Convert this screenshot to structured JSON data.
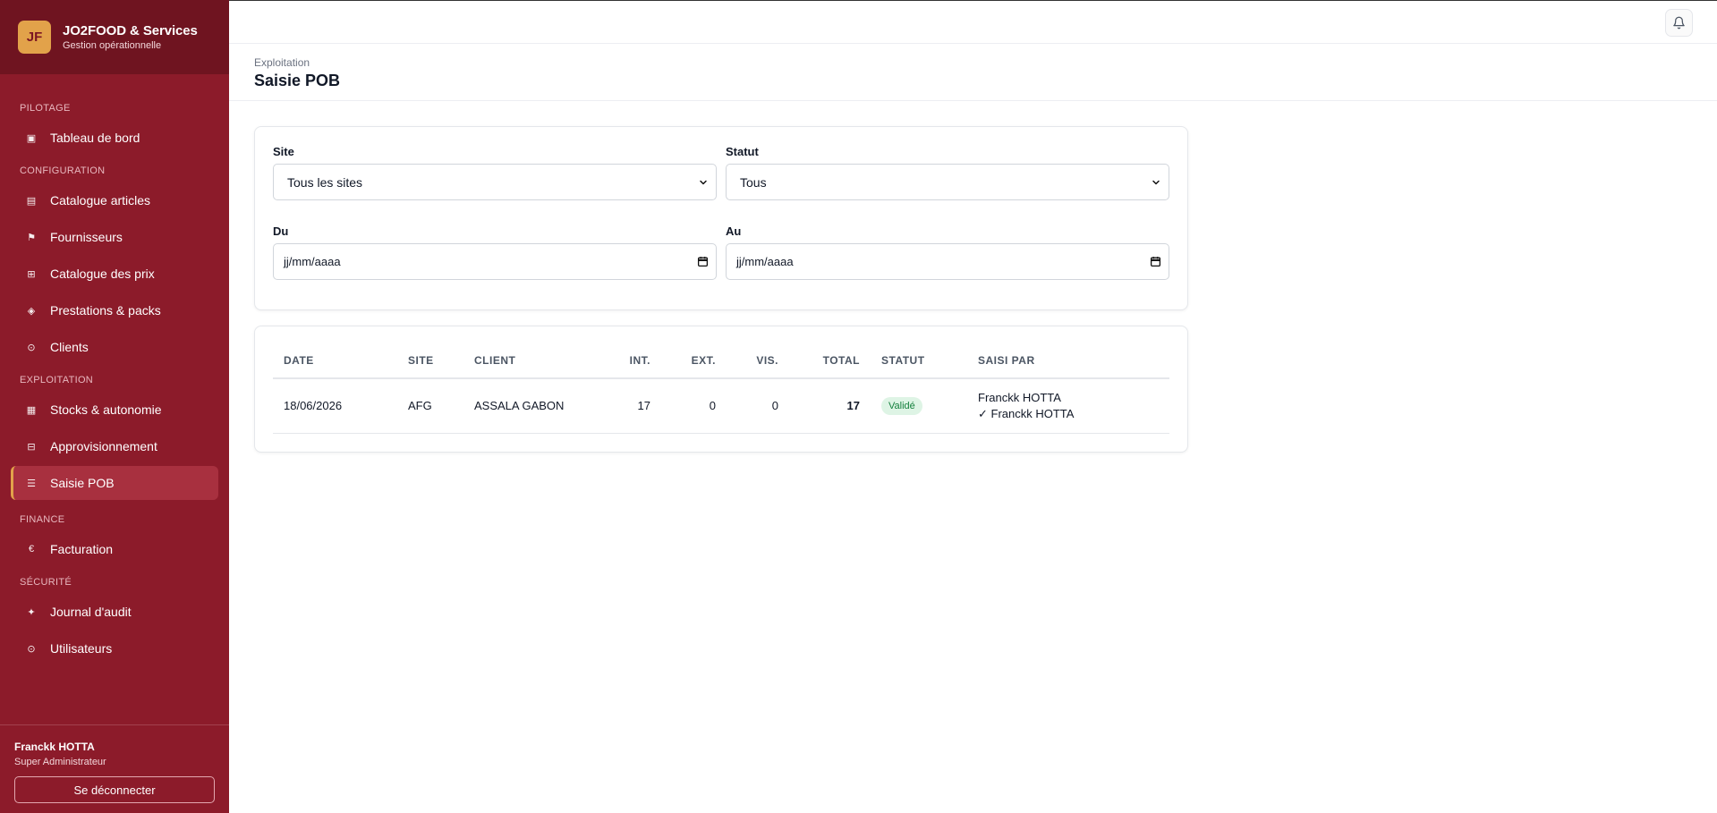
{
  "brand": {
    "logo": "JF",
    "name": "JO2FOOD & Services",
    "subtitle": "Gestion opérationnelle"
  },
  "sections": {
    "pilotage": "PILOTAGE",
    "configuration": "CONFIGURATION",
    "exploitation": "EXPLOITATION",
    "finance": "FINANCE",
    "securite": "SÉCURITÉ"
  },
  "nav": {
    "tableau": {
      "label": "Tableau de bord",
      "icon": "▣"
    },
    "catalogue_articles": {
      "label": "Catalogue articles",
      "icon": "▤"
    },
    "fournisseurs": {
      "label": "Fournisseurs",
      "icon": "⚑"
    },
    "catalogue_prix": {
      "label": "Catalogue des prix",
      "icon": "⊞"
    },
    "prestations": {
      "label": "Prestations & packs",
      "icon": "◈"
    },
    "clients": {
      "label": "Clients",
      "icon": "⊙"
    },
    "stocks": {
      "label": "Stocks & autonomie",
      "icon": "▦"
    },
    "appro": {
      "label": "Approvisionnement",
      "icon": "⊟"
    },
    "saisie_pob": {
      "label": "Saisie POB",
      "icon": "☰"
    },
    "facturation": {
      "label": "Facturation",
      "icon": "€"
    },
    "journal": {
      "label": "Journal d'audit",
      "icon": "✦"
    },
    "utilisateurs": {
      "label": "Utilisateurs",
      "icon": "⊙"
    }
  },
  "user": {
    "name": "Franckk HOTTA",
    "role": "Super Administrateur",
    "logout": "Se déconnecter"
  },
  "header": {
    "breadcrumb": "Exploitation",
    "title": "Saisie POB"
  },
  "filters": {
    "site_label": "Site",
    "site_value": "Tous les sites",
    "statut_label": "Statut",
    "statut_value": "Tous",
    "du_label": "Du",
    "du_placeholder": "jj/mm/aaaa",
    "au_label": "Au",
    "au_placeholder": "jj/mm/aaaa"
  },
  "table": {
    "headers": {
      "date": "DATE",
      "site": "SITE",
      "client": "CLIENT",
      "int": "INT.",
      "ext": "EXT.",
      "vis": "VIS.",
      "total": "TOTAL",
      "statut": "STATUT",
      "saisi_par": "SAISI PAR"
    },
    "rows": [
      {
        "date": "18/06/2026",
        "site": "AFG",
        "client": "ASSALA GABON",
        "int": "17",
        "ext": "0",
        "vis": "0",
        "total": "17",
        "statut": "Validé",
        "saisi_par": "Franckk HOTTA",
        "valide_par": "✓ Franckk HOTTA"
      }
    ]
  },
  "colors": {
    "sidebar": "#8c1b2a",
    "brand_bar": "#6f1420",
    "accent": "#e2a24a",
    "active_item": "#a8303f",
    "badge_bg": "#def4e5",
    "badge_text": "#15803d"
  }
}
